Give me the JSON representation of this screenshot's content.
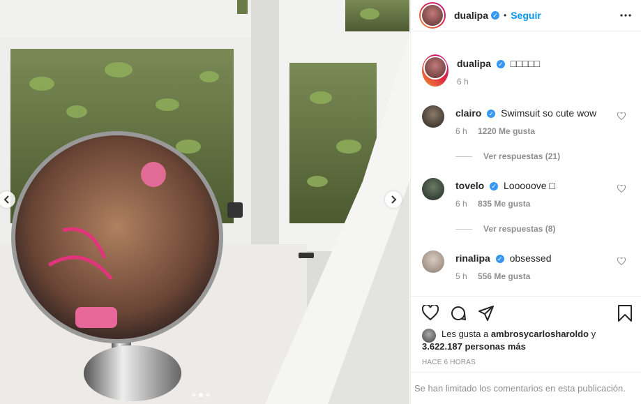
{
  "header": {
    "username": "dualipa",
    "separator": "•",
    "follow_label": "Seguir",
    "more_icon": "more-horizontal-icon"
  },
  "caption": {
    "username": "dualipa",
    "text": "□□□□□",
    "time": "6 h"
  },
  "comments": [
    {
      "username": "clairo",
      "verified": true,
      "text": "Swimsuit so cute wow",
      "time": "6 h",
      "likes": "1220 Me gusta",
      "replies": "Ver respuestas (21)"
    },
    {
      "username": "tovelo",
      "verified": true,
      "text": "Looooove □",
      "time": "6 h",
      "likes": "835 Me gusta",
      "replies": "Ver respuestas (8)"
    },
    {
      "username": "rinalipa",
      "verified": true,
      "text": "obsessed",
      "time": "5 h",
      "likes": "556 Me gusta"
    }
  ],
  "likes": {
    "line1_prefix": "Les gusta a ",
    "liker": "ambrosycarlosharoldo",
    "line1_suffix": " y",
    "count": "3.622.187 personas más"
  },
  "post_time": "HACE 6 HORAS",
  "footer_text": "Se han limitado los comentarios en esta publicación.",
  "icons": {
    "like": "heart-icon",
    "comment": "comment-icon",
    "share": "share-icon",
    "save": "bookmark-icon",
    "prev": "chevron-left-icon",
    "next": "chevron-right-icon"
  },
  "colors": {
    "accent": "#0095f6",
    "verified": "#3897f0",
    "muted": "#8e8e8e"
  },
  "carousel": {
    "slides": 3,
    "active": 2
  }
}
